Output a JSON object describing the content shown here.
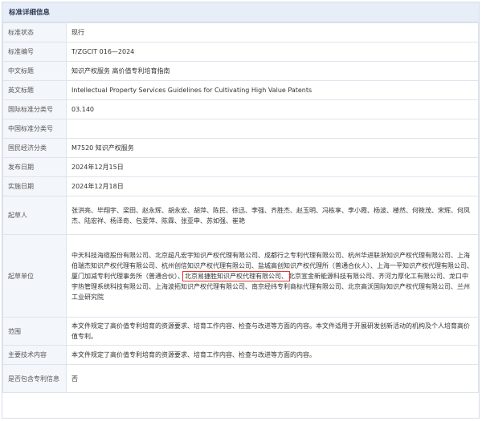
{
  "panel": {
    "title": "标准详细信息"
  },
  "rows": [
    {
      "label": "标准状态",
      "value": "现行"
    },
    {
      "label": "标准编号",
      "value": "T/ZGCIT 016—2024"
    },
    {
      "label": "中文标题",
      "value": "知识产权服务 高价值专利培育指南"
    },
    {
      "label": "英文标题",
      "value": "Intellectual Property Services Guidelines for Cultivating High Value Patents"
    },
    {
      "label": "国际标准分类号",
      "value": "03.140"
    },
    {
      "label": "中国标准分类号",
      "value": ""
    },
    {
      "label": "国民经济分类",
      "value": "M7520 知识产权服务"
    },
    {
      "label": "发布日期",
      "value": "2024年12月15日"
    },
    {
      "label": "实施日期",
      "value": "2024年12月18日"
    },
    {
      "label": "起草人",
      "value": "张洪亮、毕翔宇、梁田、赵永辉、胡永宏、胡萍、陈民、徐迅、李强、齐胜杰、赵玉明、冯栋享、李小霞、杨波、楼然、何筱茂、宋辉、何凤杰、陆宏祥、杨泽奇、包爱萍、陈霖、张亚申、苏如强、崔艳"
    },
    {
      "label": "起草单位",
      "value_before": "中天科技海缆股份有限公司、北京超凡宏宇知识产权代理有限公司、成都行之专利代理有限公司、杭州华进联浙知识产权代理有限公司、上海伯瑞杰知识产权代理有限公司、杭州创信知识产权代理有限公司、盐城高创知识产权代理所（普通合伙人）、上海一平知识产权代理有限公司、厦门加减专利代理事务所（普通合伙）、",
      "value_highlight": "北京易捷胜知识产权代理有限公司、",
      "value_after": "北京宣金新能源科技有限公司、齐河力厚化工有限公司、龙口中宇热管理系统科技有限公司、上海波拓知识产权代理有限公司、南京经纬专利商标代理有限公司、北京高沃国际知识产权代理有限公司、兰州工业研究院"
    },
    {
      "label": "范围",
      "value": "本文件规定了高价值专利培育的资源要求、培育工作内容、检查与改进等方面的内容。本文件适用于开展研发创新活动的机构及个人培育高价值专利。"
    },
    {
      "label": "主要技术内容",
      "value": "本文件规定了高价值专利培育的资源要求、培育工作内容、检查与改进等方面的内容。"
    },
    {
      "label": "是否包含专利信息",
      "value": "否"
    }
  ]
}
